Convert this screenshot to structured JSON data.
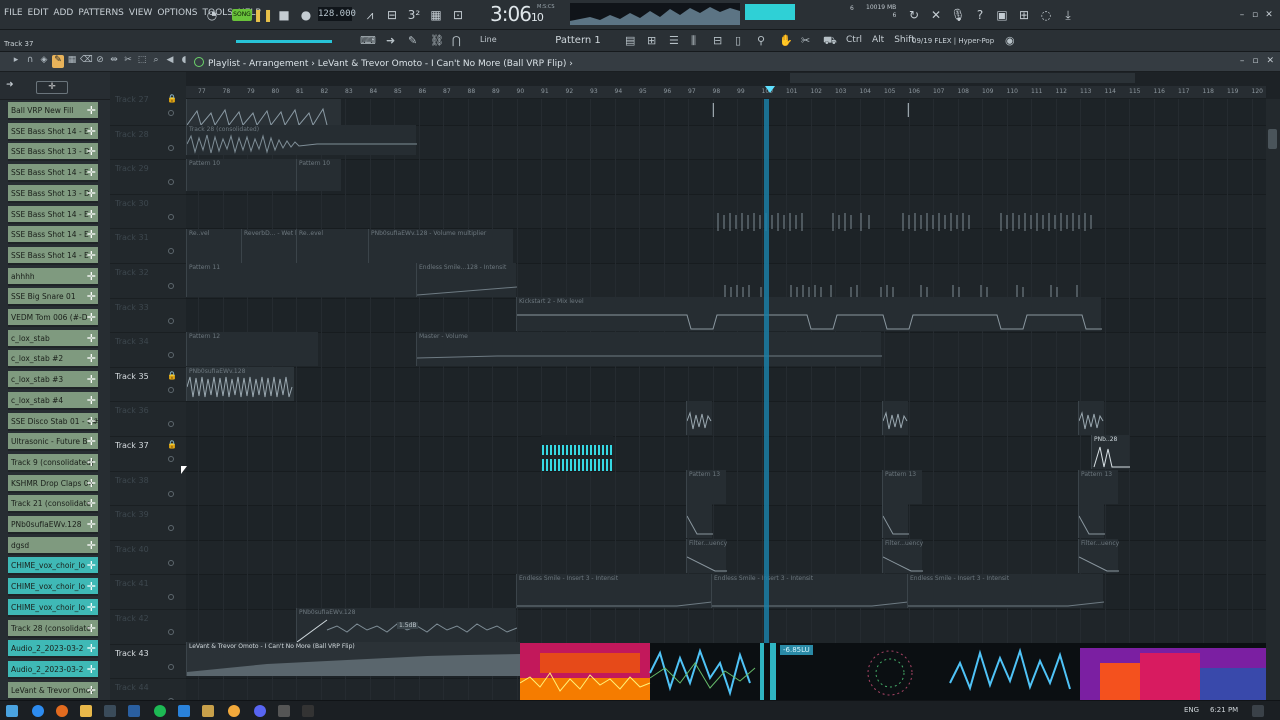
{
  "menu": [
    "FILE",
    "EDIT",
    "ADD",
    "PATTERNS",
    "VIEW",
    "OPTIONS",
    "TOOLS",
    "HELP"
  ],
  "transport": {
    "song_label": "SONG",
    "bpm": "128.000",
    "time_main": "3:06",
    "time_sub": "10",
    "time_unit": "M:S:CS",
    "voices": "6",
    "memory": "10019 MB",
    "cpu": "6"
  },
  "toolbar2": {
    "track_name": "Track 37",
    "snap": "Line",
    "pattern": "Pattern 1",
    "keys": [
      "Ctrl",
      "Alt",
      "Shift"
    ],
    "preset": "09/19  FLEX | Hyper-Pop"
  },
  "playlist": {
    "title": "Playlist - Arrangement",
    "separator": "›",
    "song": "LeVant & Trevor Omoto - I Can't No More (Ball VRP Flip)"
  },
  "picker": [
    {
      "label": "Ball VRP New Fill",
      "color": "green"
    },
    {
      "label": "SSE Bass Shot 14 - E",
      "color": "green"
    },
    {
      "label": "SSE Bass Shot 13 - D",
      "color": "green"
    },
    {
      "label": "SSE Bass Shot 14 - E",
      "color": "green"
    },
    {
      "label": "SSE Bass Shot 13 - D",
      "color": "green"
    },
    {
      "label": "SSE Bass Shot 14 - E",
      "color": "green"
    },
    {
      "label": "SSE Bass Shot 14 - E",
      "color": "green"
    },
    {
      "label": "SSE Bass Shot 14 - E",
      "color": "green"
    },
    {
      "label": "ahhhh",
      "color": "green"
    },
    {
      "label": "SSE Big Snare 01",
      "color": "green"
    },
    {
      "label": "VEDM Tom 006 (#-D",
      "color": "green"
    },
    {
      "label": "c_lox_stab",
      "color": "green"
    },
    {
      "label": "c_lox_stab #2",
      "color": "green"
    },
    {
      "label": "c_lox_stab #3",
      "color": "green"
    },
    {
      "label": "c_lox_stab #4",
      "color": "green"
    },
    {
      "label": "SSE Disco Stab 01 - C#",
      "color": "green"
    },
    {
      "label": "Ultrasonic - Future B",
      "color": "green"
    },
    {
      "label": "Track 9 (consolidated)",
      "color": "green"
    },
    {
      "label": "KSHMR Drop Claps 04",
      "color": "green"
    },
    {
      "label": "Track 21 (consolidate",
      "color": "green"
    },
    {
      "label": "PNb0sufIaEWv.128",
      "color": "green"
    },
    {
      "label": "dgsd",
      "color": "green"
    },
    {
      "label": "CHIME_vox_choir_lo",
      "color": "cyan"
    },
    {
      "label": "CHIME_vox_choir_lo",
      "color": "cyan"
    },
    {
      "label": "CHIME_vox_choir_lo",
      "color": "cyan"
    },
    {
      "label": "Track 28 (consolidate",
      "color": "green"
    },
    {
      "label": "Audio_2_2023-03-2",
      "color": "cyan"
    },
    {
      "label": "Audio_2_2023-03-2",
      "color": "cyan"
    },
    {
      "label": "LeVant & Trevor Omot",
      "color": "green"
    }
  ],
  "tracks": [
    {
      "name": "Track 27",
      "hl": false,
      "lock": true
    },
    {
      "name": "Track 28",
      "hl": false,
      "lock": false
    },
    {
      "name": "Track 29",
      "hl": false,
      "lock": false
    },
    {
      "name": "Track 30",
      "hl": false,
      "lock": false
    },
    {
      "name": "Track 31",
      "hl": false,
      "lock": false
    },
    {
      "name": "Track 32",
      "hl": false,
      "lock": false
    },
    {
      "name": "Track 33",
      "hl": false,
      "lock": false
    },
    {
      "name": "Track 34",
      "hl": false,
      "lock": false
    },
    {
      "name": "Track 35",
      "hl": true,
      "lock": true
    },
    {
      "name": "Track 36",
      "hl": false,
      "lock": false
    },
    {
      "name": "Track 37",
      "hl": true,
      "lock": true
    },
    {
      "name": "Track 38",
      "hl": false,
      "lock": false
    },
    {
      "name": "Track 39",
      "hl": false,
      "lock": false
    },
    {
      "name": "Track 40",
      "hl": false,
      "lock": false
    },
    {
      "name": "Track 41",
      "hl": false,
      "lock": false
    },
    {
      "name": "Track 42",
      "hl": false,
      "lock": false
    },
    {
      "name": "Track 43",
      "hl": true,
      "lock": false
    },
    {
      "name": "Track 44",
      "hl": false,
      "lock": false
    }
  ],
  "ruler": [
    "77",
    "78",
    "79",
    "80",
    "81",
    "82",
    "83",
    "84",
    "85",
    "86",
    "87",
    "88",
    "89",
    "90",
    "91",
    "92",
    "93",
    "94",
    "95",
    "96",
    "97",
    "98",
    "99",
    "100",
    "101",
    "102",
    "103",
    "104",
    "105",
    "106",
    "107",
    "108",
    "109",
    "110",
    "111",
    "112",
    "113",
    "114",
    "115",
    "116",
    "117",
    "118",
    "119",
    "120"
  ],
  "clips": [
    {
      "label": "Track 28 (consolidated)"
    },
    {
      "label": "Pattern 10"
    },
    {
      "label": "Pattern 10"
    },
    {
      "label": "Re..vel"
    },
    {
      "label": "ReverbD... - Wet level"
    },
    {
      "label": "Re..evel"
    },
    {
      "label": "PNb0sufIaEWv.128 - Volume multiplier"
    },
    {
      "label": "Pattern 11"
    },
    {
      "label": "Endless Smile...128 - Intensit"
    },
    {
      "label": "Kickstart 2 - Mix level"
    },
    {
      "label": "Pattern 12"
    },
    {
      "label": "Master - Volume"
    },
    {
      "label": "PNb0sufIaEWv.128"
    },
    {
      "label": "PNb..28"
    },
    {
      "label": "Pattern 13"
    },
    {
      "label": "Pattern 13"
    },
    {
      "label": "Pattern 13"
    },
    {
      "label": "Filter...uency"
    },
    {
      "label": "Filter...uency"
    },
    {
      "label": "Filter...uency"
    },
    {
      "label": "Endless Smile - Insert 3 - Intensit"
    },
    {
      "label": "Endless Smile - Insert 3 - Intensit"
    },
    {
      "label": "Endless Smile - Insert 3 - Intensit"
    },
    {
      "label": "PNb0sufIaEWv.128"
    },
    {
      "label": "LeVant & Trevor Omoto - I Can't No More (Ball VRP Flip)"
    }
  ],
  "visual": {
    "db_label": "-6.85LU",
    "fade": "1.5dB"
  },
  "taskbar": {
    "lang": "ENG",
    "clock": "6:21 PM"
  }
}
